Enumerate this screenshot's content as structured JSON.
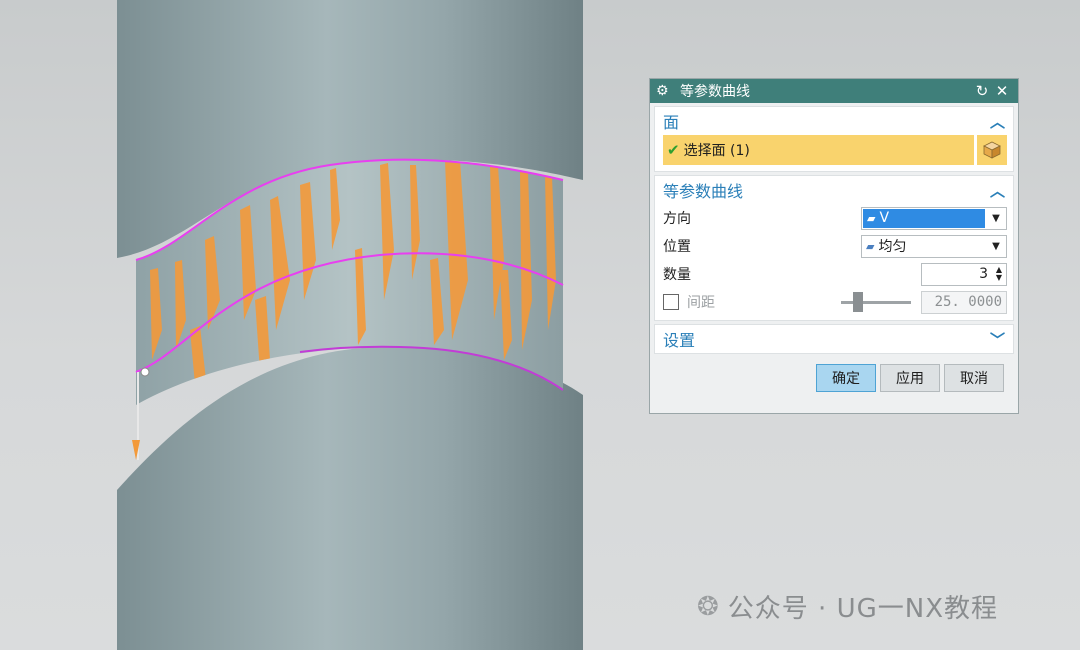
{
  "dialog": {
    "title": "等参数曲线",
    "reset_icon": "↻",
    "close_icon": "✕",
    "face_group": {
      "title": "面",
      "select_label": "选择面 (1)"
    },
    "curve_group": {
      "title": "等参数曲线",
      "direction_label": "方向",
      "direction_value": "V",
      "position_label": "位置",
      "position_value": "均匀",
      "count_label": "数量",
      "count_value": "3",
      "spacing_label": "间距",
      "spacing_value": "25. 0000"
    },
    "settings_group": {
      "title": "设置"
    },
    "buttons": {
      "ok": "确定",
      "apply": "应用",
      "cancel": "取消"
    }
  },
  "watermark": {
    "text": "公众号 · UG一NX教程"
  },
  "colors": {
    "accent_title": "#3f7f7a",
    "selection": "#f9d36d",
    "isocurve": "#e83ff0",
    "surface_highlight": "#f39a3a"
  }
}
